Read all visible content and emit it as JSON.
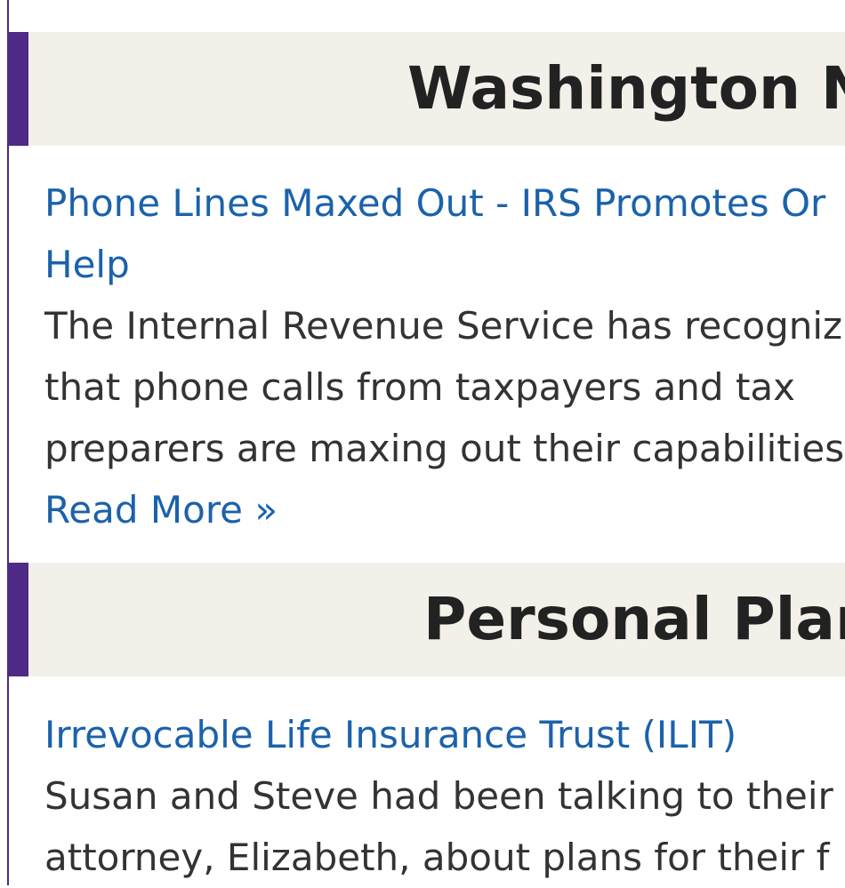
{
  "sections": [
    {
      "title": "Washington N",
      "article": {
        "headline_lines": [
          "Phone Lines Maxed Out - IRS Promotes Or",
          "Help"
        ],
        "excerpt_lines": [
          "The Internal Revenue Service has recogniz",
          "that phone calls from taxpayers and tax",
          "preparers are maxing out their capabilities"
        ],
        "read_more": "Read More »"
      }
    },
    {
      "title": "Personal Plar",
      "article": {
        "headline_lines": [
          "Irrevocable Life Insurance Trust (ILIT)"
        ],
        "excerpt_lines": [
          "Susan and Steve had been talking to their",
          "attorney, Elizabeth, about plans for their f"
        ]
      }
    }
  ],
  "colors": {
    "accent": "#4f2a86",
    "header_background": "#f2f0e8",
    "link": "#1b62ab",
    "text": "#333333"
  }
}
